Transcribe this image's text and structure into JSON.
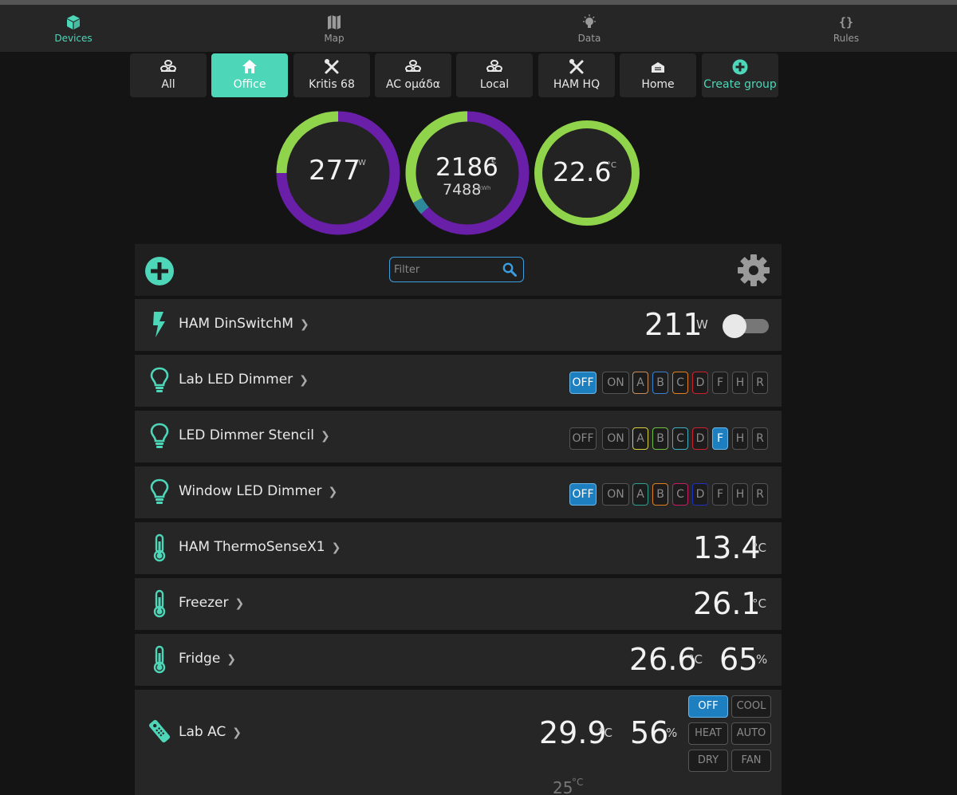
{
  "nav": {
    "items": [
      {
        "label": "Devices",
        "icon": "cube-icon"
      },
      {
        "label": "Map",
        "icon": "map-icon"
      },
      {
        "label": "Data",
        "icon": "bulb-icon"
      },
      {
        "label": "Rules",
        "icon": "braces-icon"
      }
    ],
    "active": "Devices"
  },
  "groups": {
    "items": [
      {
        "label": "All",
        "icon": "stack-icon"
      },
      {
        "label": "Office",
        "icon": "house-icon"
      },
      {
        "label": "Kritis 68",
        "icon": "tools-icon"
      },
      {
        "label": "AC ομάδα",
        "icon": "stack-icon"
      },
      {
        "label": "Local",
        "icon": "stack-icon"
      },
      {
        "label": "HAM HQ",
        "icon": "tools-icon"
      },
      {
        "label": "Home",
        "icon": "warehouse-icon"
      },
      {
        "label": "Create group",
        "icon": "plus-circle-icon"
      }
    ],
    "active": "Office"
  },
  "gauges": {
    "power": {
      "value": "277",
      "unit": "W",
      "fraction": 0.75
    },
    "energy": {
      "value": "2186",
      "unit": "€",
      "sub_value": "7488",
      "sub_unit": "kWh",
      "fraction": 0.33
    },
    "temperature": {
      "value": "22.6",
      "unit": "°C",
      "fraction": 1.0
    }
  },
  "toolbar": {
    "filter_placeholder": "Filter"
  },
  "devices": {
    "din_switch": {
      "name": "HAM DinSwitchM",
      "power": "211",
      "power_unit": "W",
      "state": "off"
    },
    "lab_led": {
      "name": "Lab LED Dimmer"
    },
    "stencil_led": {
      "name": "LED Dimmer Stencil"
    },
    "window_led": {
      "name": "Window LED Dimmer"
    },
    "thermo": {
      "name": "HAM ThermoSenseX1",
      "temp": "13.4",
      "temp_unit": "°C"
    },
    "freezer": {
      "name": "Freezer",
      "temp": "26.1",
      "temp_unit": "°C"
    },
    "fridge": {
      "name": "Fridge",
      "temp": "26.6",
      "temp_unit": "°C",
      "humidity": "65",
      "humidity_unit": "%"
    },
    "lab_ac": {
      "name": "Lab AC",
      "temp": "29.9",
      "temp_unit": "°C",
      "humidity": "56",
      "humidity_unit": "%",
      "setpoint": "25",
      "setpoint_unit": "°C"
    }
  },
  "scene_labels": {
    "off": "OFF",
    "on": "ON",
    "a": "A",
    "b": "B",
    "c": "C",
    "d": "D",
    "f": "F",
    "h": "H",
    "r": "R"
  },
  "ac_modes": {
    "off": "OFF",
    "cool": "COOL",
    "heat": "HEAT",
    "auto": "AUTO",
    "dry": "DRY",
    "fan": "FAN"
  },
  "colors": {
    "accent": "#4ed6b8",
    "gauge_purple": "#6a1fa8",
    "gauge_green": "#8fd44a",
    "selected_blue": "#1d7fc0"
  }
}
